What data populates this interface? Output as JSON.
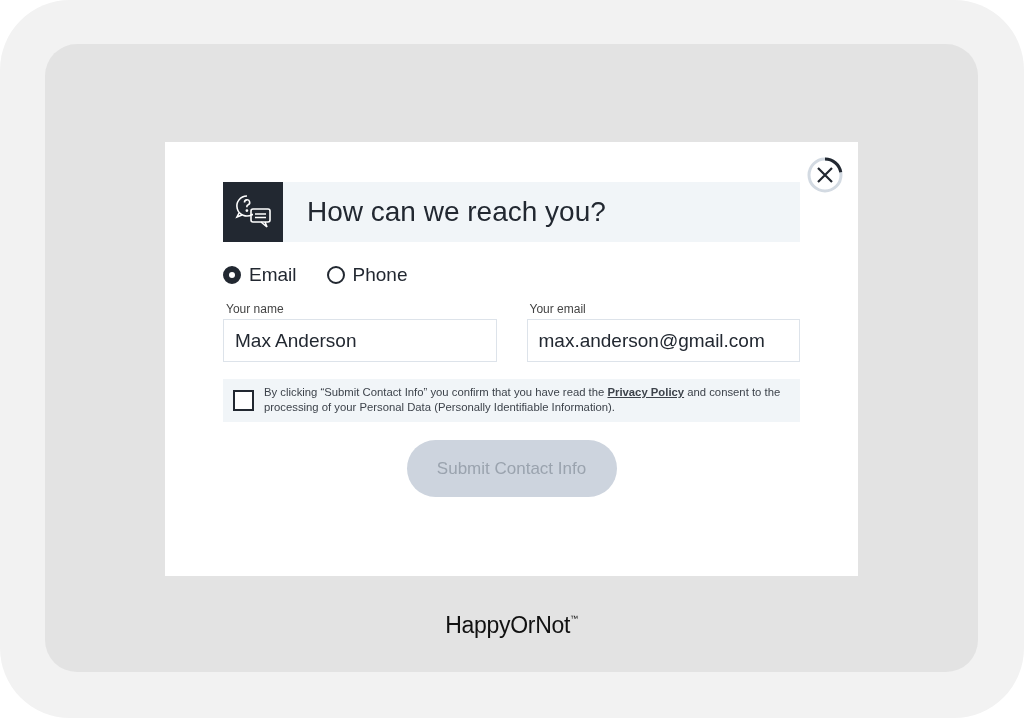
{
  "dialog": {
    "title": "How can we reach you?",
    "close_timer": {
      "level": 0.22
    }
  },
  "contact_methods": [
    {
      "label": "Email",
      "selected": true
    },
    {
      "label": "Phone",
      "selected": false
    }
  ],
  "fields": [
    {
      "label": "Your name",
      "value": "Max Anderson"
    },
    {
      "label": "Your email",
      "value": "max.anderson@gmail.com"
    }
  ],
  "consent": {
    "checked": false,
    "text_before": "By clicking “Submit Contact Info” you confirm that you have read the",
    "link": "Privacy Policy",
    "text_after": "and consent to the processing of your Personal Data (Personally Identifiable Information)."
  },
  "submit": {
    "label": "Submit Contact Info",
    "disabled": true
  },
  "brand": "HappyOrNot$^{™}$"
}
